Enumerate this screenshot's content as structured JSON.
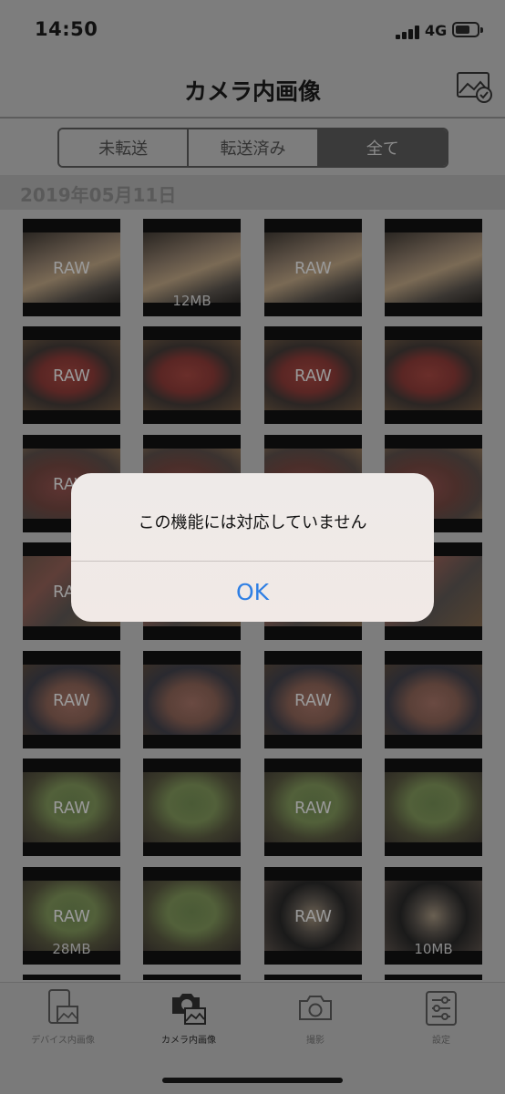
{
  "status_bar": {
    "time": "14:50",
    "network": "4G"
  },
  "nav": {
    "title": "カメラ内画像",
    "right_icon": "image-check-icon"
  },
  "segment": {
    "tabs": [
      "未転送",
      "転送済み",
      "全て"
    ],
    "selected": "全て"
  },
  "date_header": "2019年05月11日",
  "grid": {
    "thumbnails": [
      {
        "badge": "RAW",
        "size": ""
      },
      {
        "badge": "",
        "size": "12MB"
      },
      {
        "badge": "RAW",
        "size": ""
      },
      {
        "badge": "",
        "size": ""
      },
      {
        "badge": "RAW",
        "size": ""
      },
      {
        "badge": "",
        "size": ""
      },
      {
        "badge": "RAW",
        "size": ""
      },
      {
        "badge": "",
        "size": ""
      },
      {
        "badge": "RAW",
        "size": ""
      },
      {
        "badge": "",
        "size": ""
      },
      {
        "badge": "",
        "size": ""
      },
      {
        "badge": "",
        "size": ""
      },
      {
        "badge": "RAW",
        "size": ""
      },
      {
        "badge": "",
        "size": ""
      },
      {
        "badge": "",
        "size": ""
      },
      {
        "badge": "",
        "size": ""
      },
      {
        "badge": "RAW",
        "size": ""
      },
      {
        "badge": "",
        "size": ""
      },
      {
        "badge": "RAW",
        "size": ""
      },
      {
        "badge": "",
        "size": ""
      },
      {
        "badge": "RAW",
        "size": ""
      },
      {
        "badge": "",
        "size": ""
      },
      {
        "badge": "RAW",
        "size": ""
      },
      {
        "badge": "",
        "size": ""
      },
      {
        "badge": "RAW",
        "size": "28MB"
      },
      {
        "badge": "",
        "size": ""
      },
      {
        "badge": "RAW",
        "size": ""
      },
      {
        "badge": "",
        "size": "10MB"
      }
    ]
  },
  "tab_bar": {
    "items": [
      {
        "label": "デバイス内画像",
        "icon": "device-images-icon"
      },
      {
        "label": "カメラ内画像",
        "icon": "camera-images-icon"
      },
      {
        "label": "撮影",
        "icon": "camera-icon"
      },
      {
        "label": "設定",
        "icon": "settings-sliders-icon"
      }
    ],
    "selected": "カメラ内画像"
  },
  "alert": {
    "message": "この機能には対応していません",
    "button": "OK"
  }
}
